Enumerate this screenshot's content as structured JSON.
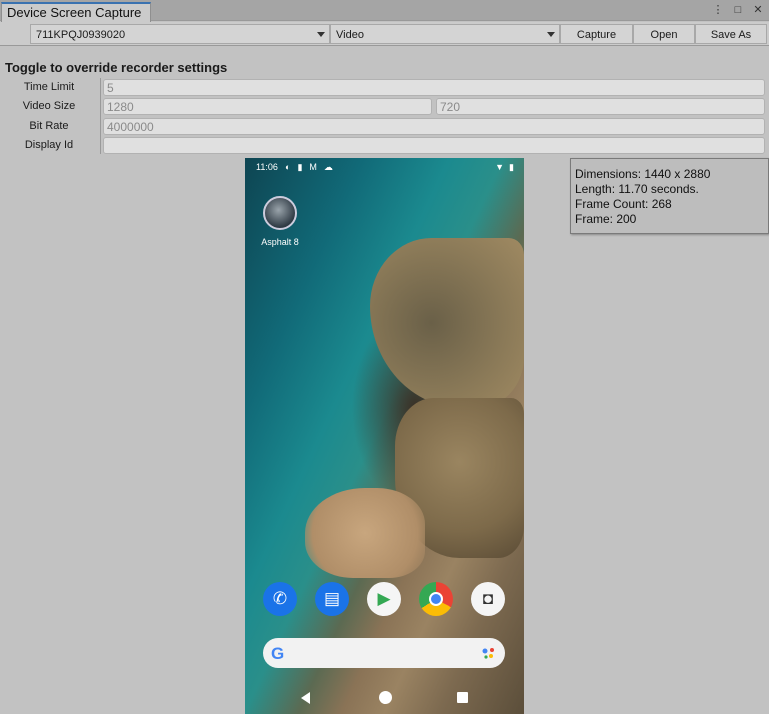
{
  "tab": {
    "title": "Device Screen Capture"
  },
  "toolbar": {
    "device": "711KPQJ0939020",
    "mode": "Video",
    "capture_label": "Capture",
    "open_label": "Open",
    "save_as_label": "Save As"
  },
  "heading": "Toggle to override recorder settings",
  "settings": {
    "time_limit_label": "Time Limit",
    "time_limit_value": "5",
    "video_size_label": "Video Size",
    "video_width": "1280",
    "video_height": "720",
    "bit_rate_label": "Bit Rate",
    "bit_rate_value": "4000000",
    "display_id_label": "Display Id",
    "display_id_value": ""
  },
  "phone": {
    "time": "11:06",
    "app_label": "Asphalt 8",
    "dock_icons": [
      "phone-icon",
      "messages-icon",
      "play-store-icon",
      "chrome-icon",
      "camera-icon"
    ],
    "search_logo": "G"
  },
  "info": {
    "dimensions": "Dimensions: 1440 x 2880",
    "length": "Length: 11.70 seconds.",
    "frame_count": "Frame Count: 268",
    "frame": "Frame: 200"
  },
  "colors": {
    "tab_accent": "#3a72b0",
    "panel_bg": "#c2c2c2"
  }
}
